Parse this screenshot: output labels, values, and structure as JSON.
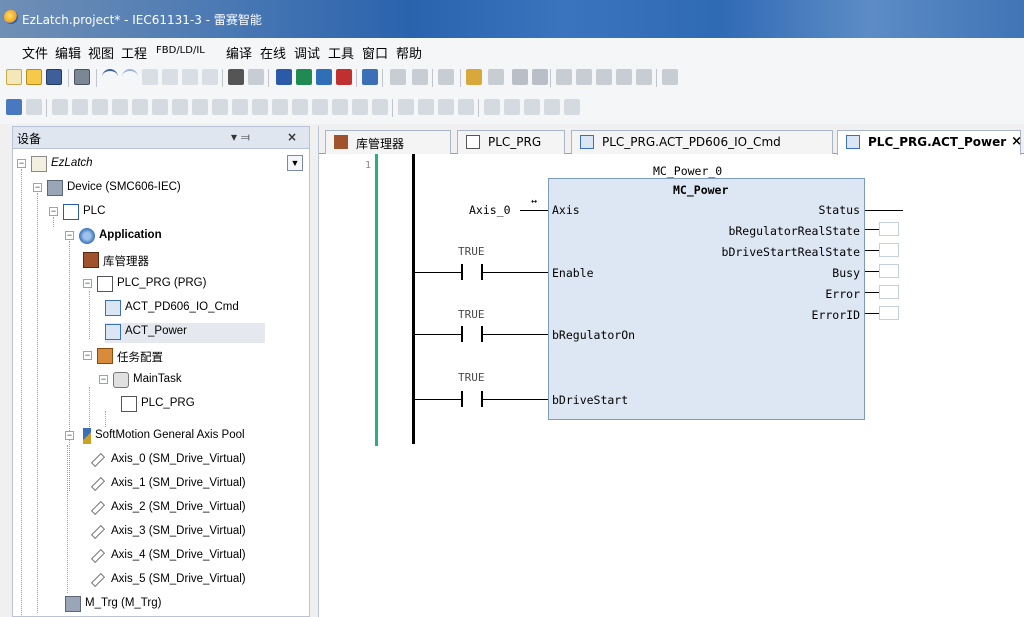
{
  "window": {
    "title": "EzLatch.project* - IEC61131-3 - 雷赛智能"
  },
  "menu": [
    "文件",
    "编辑",
    "视图",
    "工程",
    "FBD/LD/IL",
    "编译",
    "在线",
    "调试",
    "工具",
    "窗口",
    "帮助"
  ],
  "panel": {
    "title": "设备",
    "pin": "▾  ⫤",
    "close": "×"
  },
  "tree": {
    "root": "EzLatch",
    "device": "Device (SMC606-IEC)",
    "plc": "PLC",
    "application": "Application",
    "library": "库管理器",
    "plc_prg": "PLC_PRG (PRG)",
    "act1": "ACT_PD606_IO_Cmd",
    "act2": "ACT_Power",
    "task_config": "任务配置",
    "main_task": "MainTask",
    "task_prg": "PLC_PRG",
    "axis_pool": "SoftMotion General Axis Pool",
    "axes": [
      "Axis_0 (SM_Drive_Virtual)",
      "Axis_1 (SM_Drive_Virtual)",
      "Axis_2 (SM_Drive_Virtual)",
      "Axis_3 (SM_Drive_Virtual)",
      "Axis_4 (SM_Drive_Virtual)",
      "Axis_5 (SM_Drive_Virtual)"
    ],
    "mtrg": "M_Trg (M_Trg)"
  },
  "tabs": [
    {
      "label": "库管理器"
    },
    {
      "label": "PLC_PRG"
    },
    {
      "label": "PLC_PRG.ACT_PD606_IO_Cmd"
    },
    {
      "label": "PLC_PRG.ACT_Power",
      "active": true
    }
  ],
  "editor": {
    "line_number": "1",
    "instance_name": "MC_Power_0",
    "fb_type": "MC_Power",
    "axis_var": "Axis_0",
    "axis_arrow": "↔",
    "inputs": [
      "Axis",
      "Enable",
      "bRegulatorOn",
      "bDriveStart"
    ],
    "outputs": [
      "Status",
      "bRegulatorRealState",
      "bDriveStartRealState",
      "Busy",
      "Error",
      "ErrorID"
    ],
    "contact_value": "TRUE"
  },
  "colors": {
    "title_gradient": "#2a63ad",
    "fb_fill": "#dde7f3",
    "gutter_bar": "#2ab07e"
  }
}
